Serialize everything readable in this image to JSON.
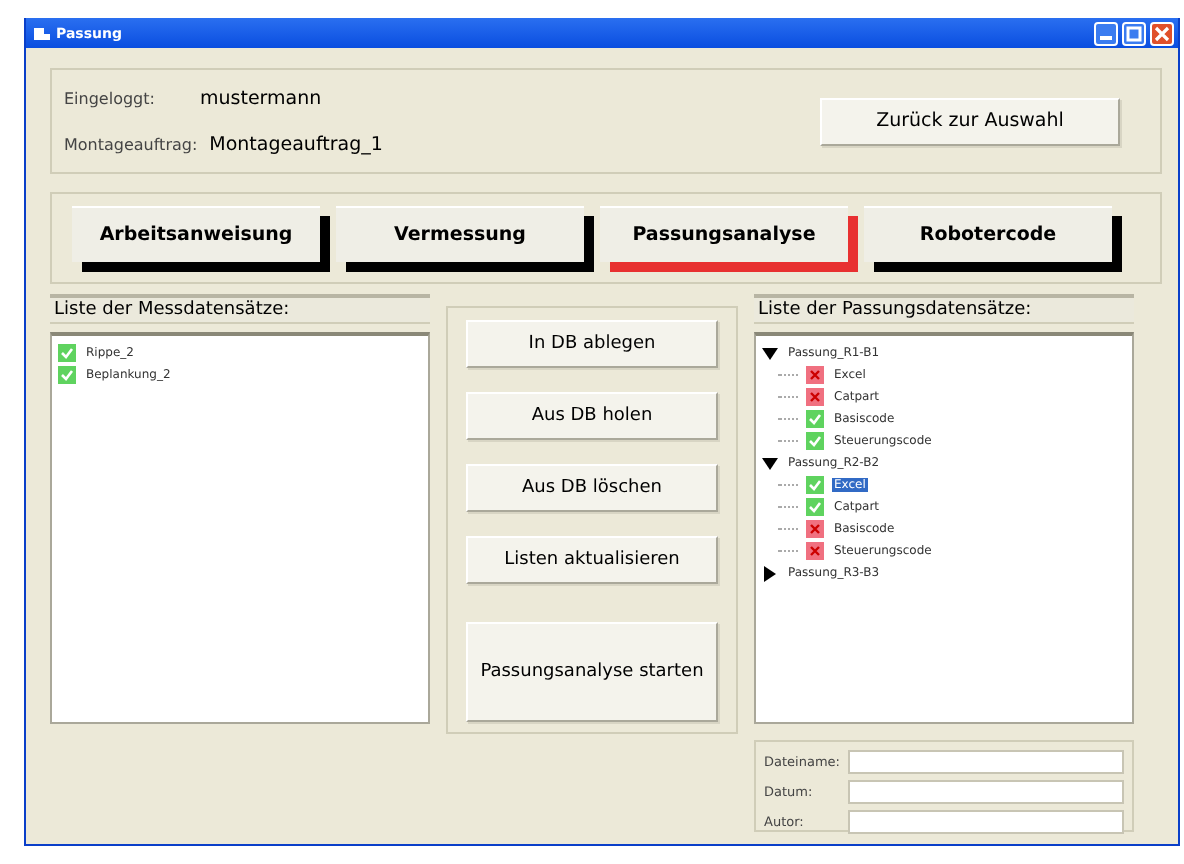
{
  "window": {
    "title": "Passung"
  },
  "session": {
    "user_label": "Eingeloggt:",
    "user": "mustermann",
    "order_label": "Montageauftrag:",
    "order": "Montageauftrag_1",
    "back_button": "Zurück zur Auswahl"
  },
  "tabs": [
    {
      "label": "Arbeitsanweisung",
      "selected": false
    },
    {
      "label": "Vermessung",
      "selected": false
    },
    {
      "label": "Passungsanalyse",
      "selected": true
    },
    {
      "label": "Robotercode",
      "selected": false
    }
  ],
  "measurement_list": {
    "title": "Liste der Messdatensätze:",
    "items": [
      {
        "label": "Rippe_2",
        "passed": true
      },
      {
        "label": "Beplankung_2",
        "passed": true
      }
    ]
  },
  "actions": [
    "In DB ablegen",
    "Aus DB holen",
    "Aus DB löschen",
    "Listen aktualisieren",
    "Passungsanalyse starten"
  ],
  "fit_list": {
    "title": "Liste der Passungsdatensätze:",
    "items": [
      {
        "label": "Passung_R1-B1",
        "expanded": true,
        "children": [
          {
            "label": "Excel",
            "passed": false,
            "selected": false
          },
          {
            "label": "Catpart",
            "passed": false,
            "selected": false
          },
          {
            "label": "Basiscode",
            "passed": true,
            "selected": false
          },
          {
            "label": "Steuerungscode",
            "passed": true,
            "selected": false
          }
        ]
      },
      {
        "label": "Passung_R2-B2",
        "expanded": true,
        "children": [
          {
            "label": "Excel",
            "passed": true,
            "selected": true
          },
          {
            "label": "Catpart",
            "passed": true,
            "selected": false
          },
          {
            "label": "Basiscode",
            "passed": false,
            "selected": false
          },
          {
            "label": "Steuerungscode",
            "passed": false,
            "selected": false
          }
        ]
      },
      {
        "label": "Passung_R3-B3",
        "expanded": false
      }
    ]
  },
  "details": [
    {
      "label": "Dateiname:"
    },
    {
      "label": "Datum:"
    },
    {
      "label": "Autor:"
    }
  ]
}
